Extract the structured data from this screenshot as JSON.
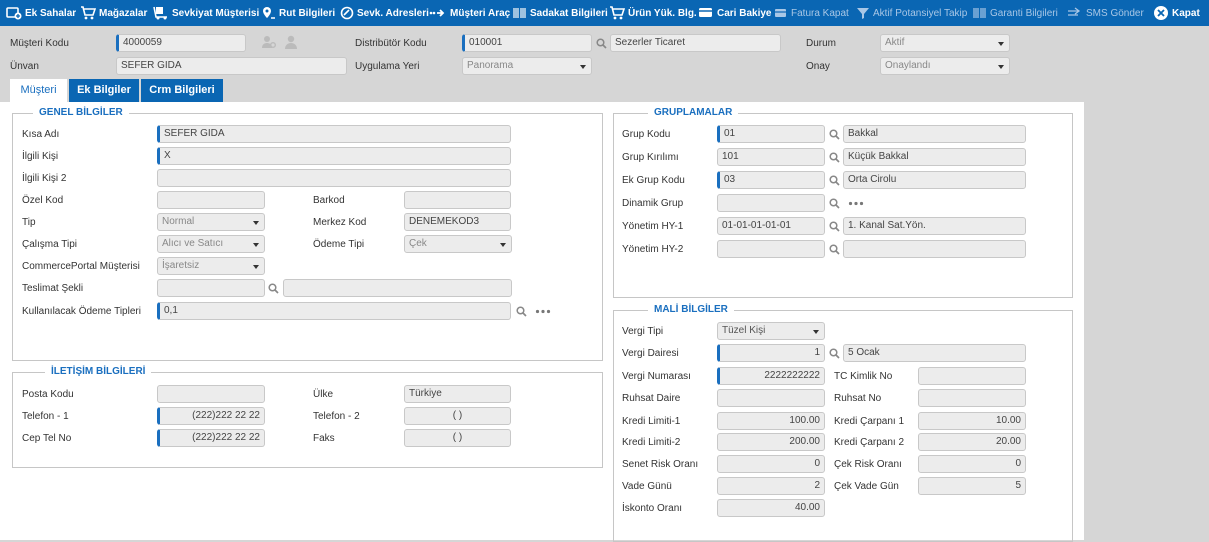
{
  "toolbar": {
    "ek_sahalar": "Ek Sahalar",
    "magazalar": "Mağazalar",
    "sevkiyat_musterisi": "Sevkiyat Müşterisi",
    "rut_bilgileri": "Rut Bilgileri",
    "sevk_adresleri": "Sevk. Adresleri",
    "musteri_arac": "Müşteri Araç",
    "sadakat_bilgileri": "Sadakat Bilgileri",
    "urun_yuk_blg": "Ürün Yük. Blg.",
    "cari_bakiye": "Cari Bakiye",
    "fatura_kapat": "Fatura Kapat",
    "aktif_potansiyel_takip": "Aktif Potansiyel Takip",
    "garanti_bilgileri": "Garanti Bilgileri",
    "sms_gonder": "SMS Gönder",
    "kapat": "Kapat"
  },
  "header": {
    "musteri_kodu_label": "Müşteri Kodu",
    "musteri_kodu": "4000059",
    "unvan_label": "Ünvan",
    "unvan": "SEFER GIDA",
    "distributor_kodu_label": "Distribütör Kodu",
    "distributor_kodu": "010001",
    "distributor_adi": "Sezerler Ticaret",
    "uygulama_yeri_label": "Uygulama Yeri",
    "uygulama_yeri": "Panorama",
    "durum_label": "Durum",
    "durum": "Aktif",
    "onay_label": "Onay",
    "onay": "Onaylandı"
  },
  "tabs": {
    "musteri": "Müşteri",
    "ek_bilgiler": "Ek Bilgiler",
    "crm_bilgileri": "Crm Bilgileri"
  },
  "genel": {
    "title": "GENEL BİLGİLER",
    "kisa_adi_label": "Kısa Adı",
    "kisa_adi": "SEFER GIDA",
    "ilgili_kisi_label": "İlgili Kişi",
    "ilgili_kisi": "X",
    "ilgili_kisi2_label": "İlgili Kişi 2",
    "ilgili_kisi2": "",
    "ozel_kod_label": "Özel Kod",
    "ozel_kod": "",
    "barkod_label": "Barkod",
    "barkod": "",
    "tip_label": "Tip",
    "tip": "Normal",
    "merkez_kod_label": "Merkez Kod",
    "merkez_kod": "DENEMEKOD3",
    "calisma_tipi_label": "Çalışma Tipi",
    "calisma_tipi": "Alıcı ve Satıcı",
    "odeme_tipi_label": "Ödeme Tipi",
    "odeme_tipi": "Çek",
    "commerce_label": "CommercePortal Müşterisi",
    "commerce": "İşaretsiz",
    "teslimat_label": "Teslimat Şekli",
    "teslimat_kod": "",
    "teslimat_adi": "",
    "odeme_tipleri_label": "Kullanılacak Ödeme Tipleri",
    "odeme_tipleri": "0,1"
  },
  "iletisim": {
    "title": "İLETİŞİM BİLGİLERİ",
    "posta_kodu_label": "Posta Kodu",
    "posta_kodu": "",
    "ulke_label": "Ülke",
    "ulke": "Türkiye",
    "telefon1_label": "Telefon - 1",
    "telefon1": "(222)222 22 22",
    "telefon2_label": "Telefon - 2",
    "telefon2": "(   )",
    "cep_label": "Cep Tel No",
    "cep": "(222)222 22 22",
    "faks_label": "Faks",
    "faks": "(   )"
  },
  "gruplamalar": {
    "title": "GRUPLAMALAR",
    "grup_kodu_label": "Grup Kodu",
    "grup_kodu": "01",
    "grup_kodu_adi": "Bakkal",
    "grup_kirilimi_label": "Grup Kırılımı",
    "grup_kirilimi": "101",
    "grup_kirilimi_adi": "Küçük Bakkal",
    "ek_grup_kodu_label": "Ek Grup Kodu",
    "ek_grup_kodu": "03",
    "ek_grup_kodu_adi": "Orta Cirolu",
    "dinamik_grup_label": "Dinamik Grup",
    "dinamik_grup": "",
    "yonetim_hy1_label": "Yönetim HY-1",
    "yonetim_hy1": "01-01-01-01-01",
    "yonetim_hy1_adi": "1. Kanal Sat.Yön.",
    "yonetim_hy2_label": "Yönetim HY-2",
    "yonetim_hy2": "",
    "yonetim_hy2_adi": ""
  },
  "mali": {
    "title": "MALİ BİLGİLER",
    "vergi_tipi_label": "Vergi Tipi",
    "vergi_tipi": "Tüzel Kişi",
    "vergi_dairesi_label": "Vergi Dairesi",
    "vergi_dairesi": "1",
    "vergi_dairesi_adi": "5 Ocak",
    "vergi_numarasi_label": "Vergi Numarası",
    "vergi_numarasi": "2222222222",
    "tc_kimlik_label": "TC Kimlik No",
    "tc_kimlik": "",
    "ruhsat_daire_label": "Ruhsat Daire",
    "ruhsat_daire": "",
    "ruhsat_no_label": "Ruhsat No",
    "ruhsat_no": "",
    "kredi_limiti1_label": "Kredi Limiti-1",
    "kredi_limiti1": "100.00",
    "kredi_carpani1_label": "Kredi Çarpanı 1",
    "kredi_carpani1": "10.00",
    "kredi_limiti2_label": "Kredi Limiti-2",
    "kredi_limiti2": "200.00",
    "kredi_carpani2_label": "Kredi Çarpanı 2",
    "kredi_carpani2": "20.00",
    "senet_risk_label": "Senet Risk Oranı",
    "senet_risk": "0",
    "cek_risk_label": "Çek Risk Oranı",
    "cek_risk": "0",
    "vade_gunu_label": "Vade Günü",
    "vade_gunu": "2",
    "cek_vade_label": "Çek Vade Gün",
    "cek_vade": "5",
    "iskonto_label": "İskonto Oranı",
    "iskonto": "40.00"
  },
  "colors": {
    "toolbar": "#0a66b3",
    "accent": "#1a6fbf",
    "field_bg": "#ececec"
  }
}
